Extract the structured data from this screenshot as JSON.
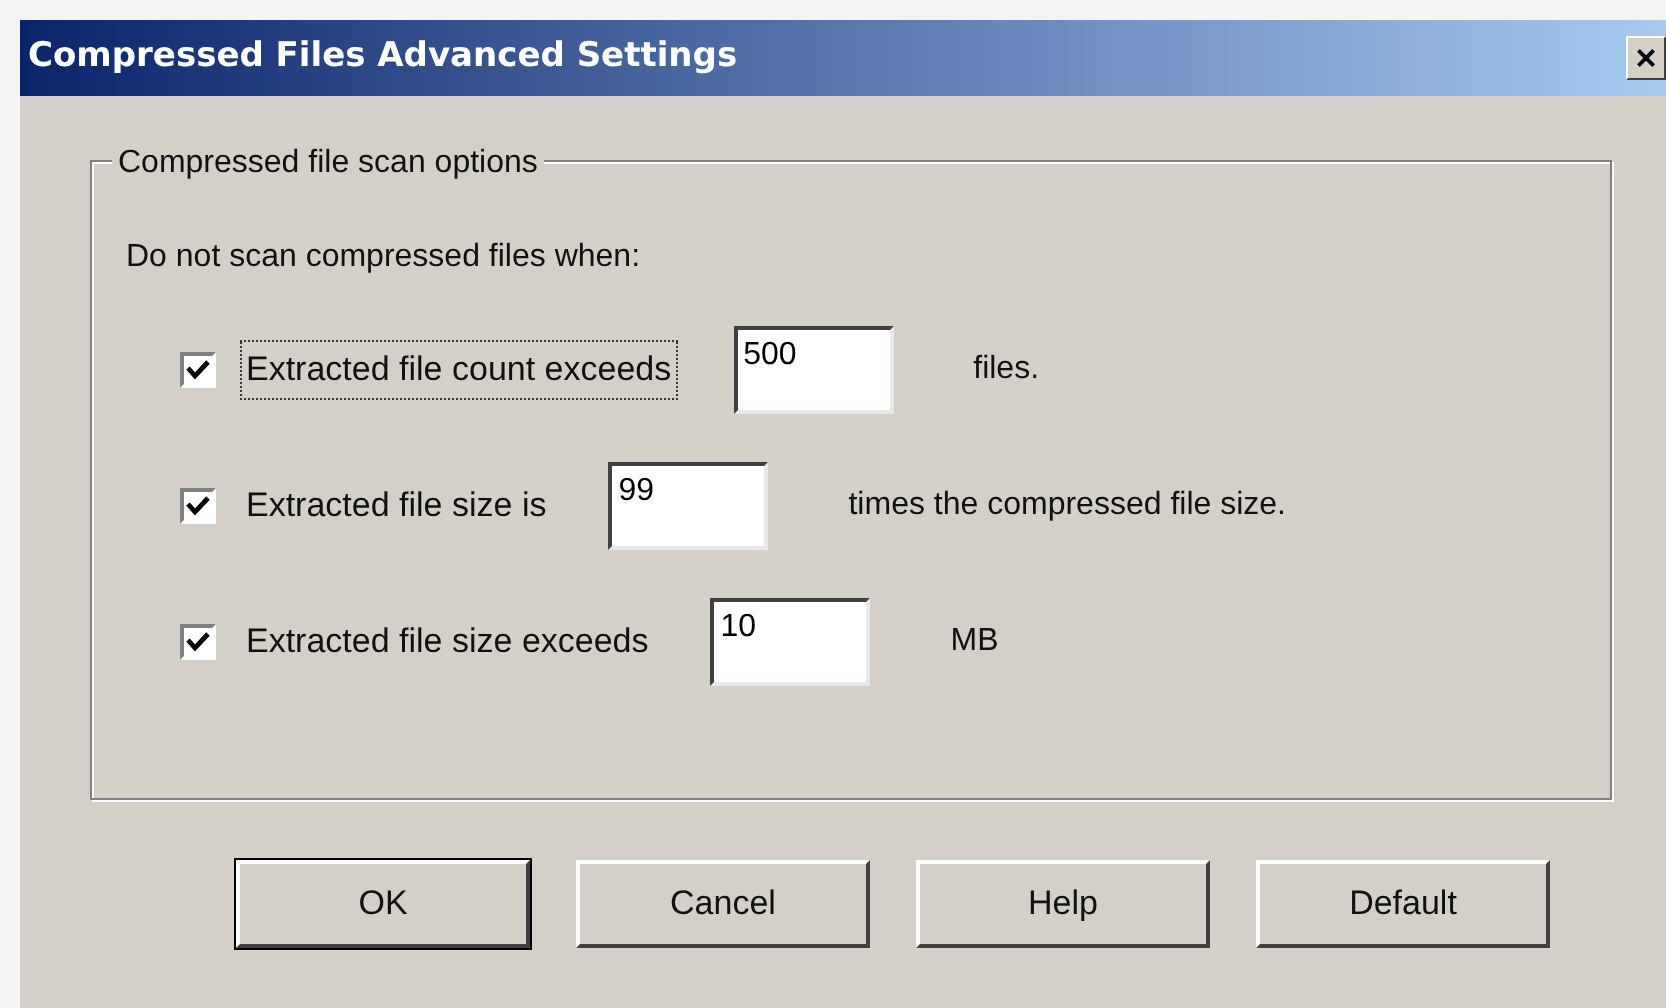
{
  "window": {
    "title": "Compressed Files Advanced Settings",
    "close": "×"
  },
  "group": {
    "title": "Compressed file scan options",
    "intro": "Do not scan compressed files when:",
    "options": [
      {
        "label": "Extracted file count exceeds",
        "checked": true,
        "focused": true,
        "value": "500",
        "suffix": "files."
      },
      {
        "label": "Extracted file size is",
        "checked": true,
        "focused": false,
        "value": "99",
        "suffix": "times the compressed file size."
      },
      {
        "label": "Extracted file size exceeds",
        "checked": true,
        "focused": false,
        "value": "10",
        "suffix": "MB"
      }
    ]
  },
  "buttons": [
    {
      "label": "OK",
      "default": true
    },
    {
      "label": "Cancel",
      "default": false
    },
    {
      "label": "Help",
      "default": false
    },
    {
      "label": "Default",
      "default": false
    }
  ]
}
